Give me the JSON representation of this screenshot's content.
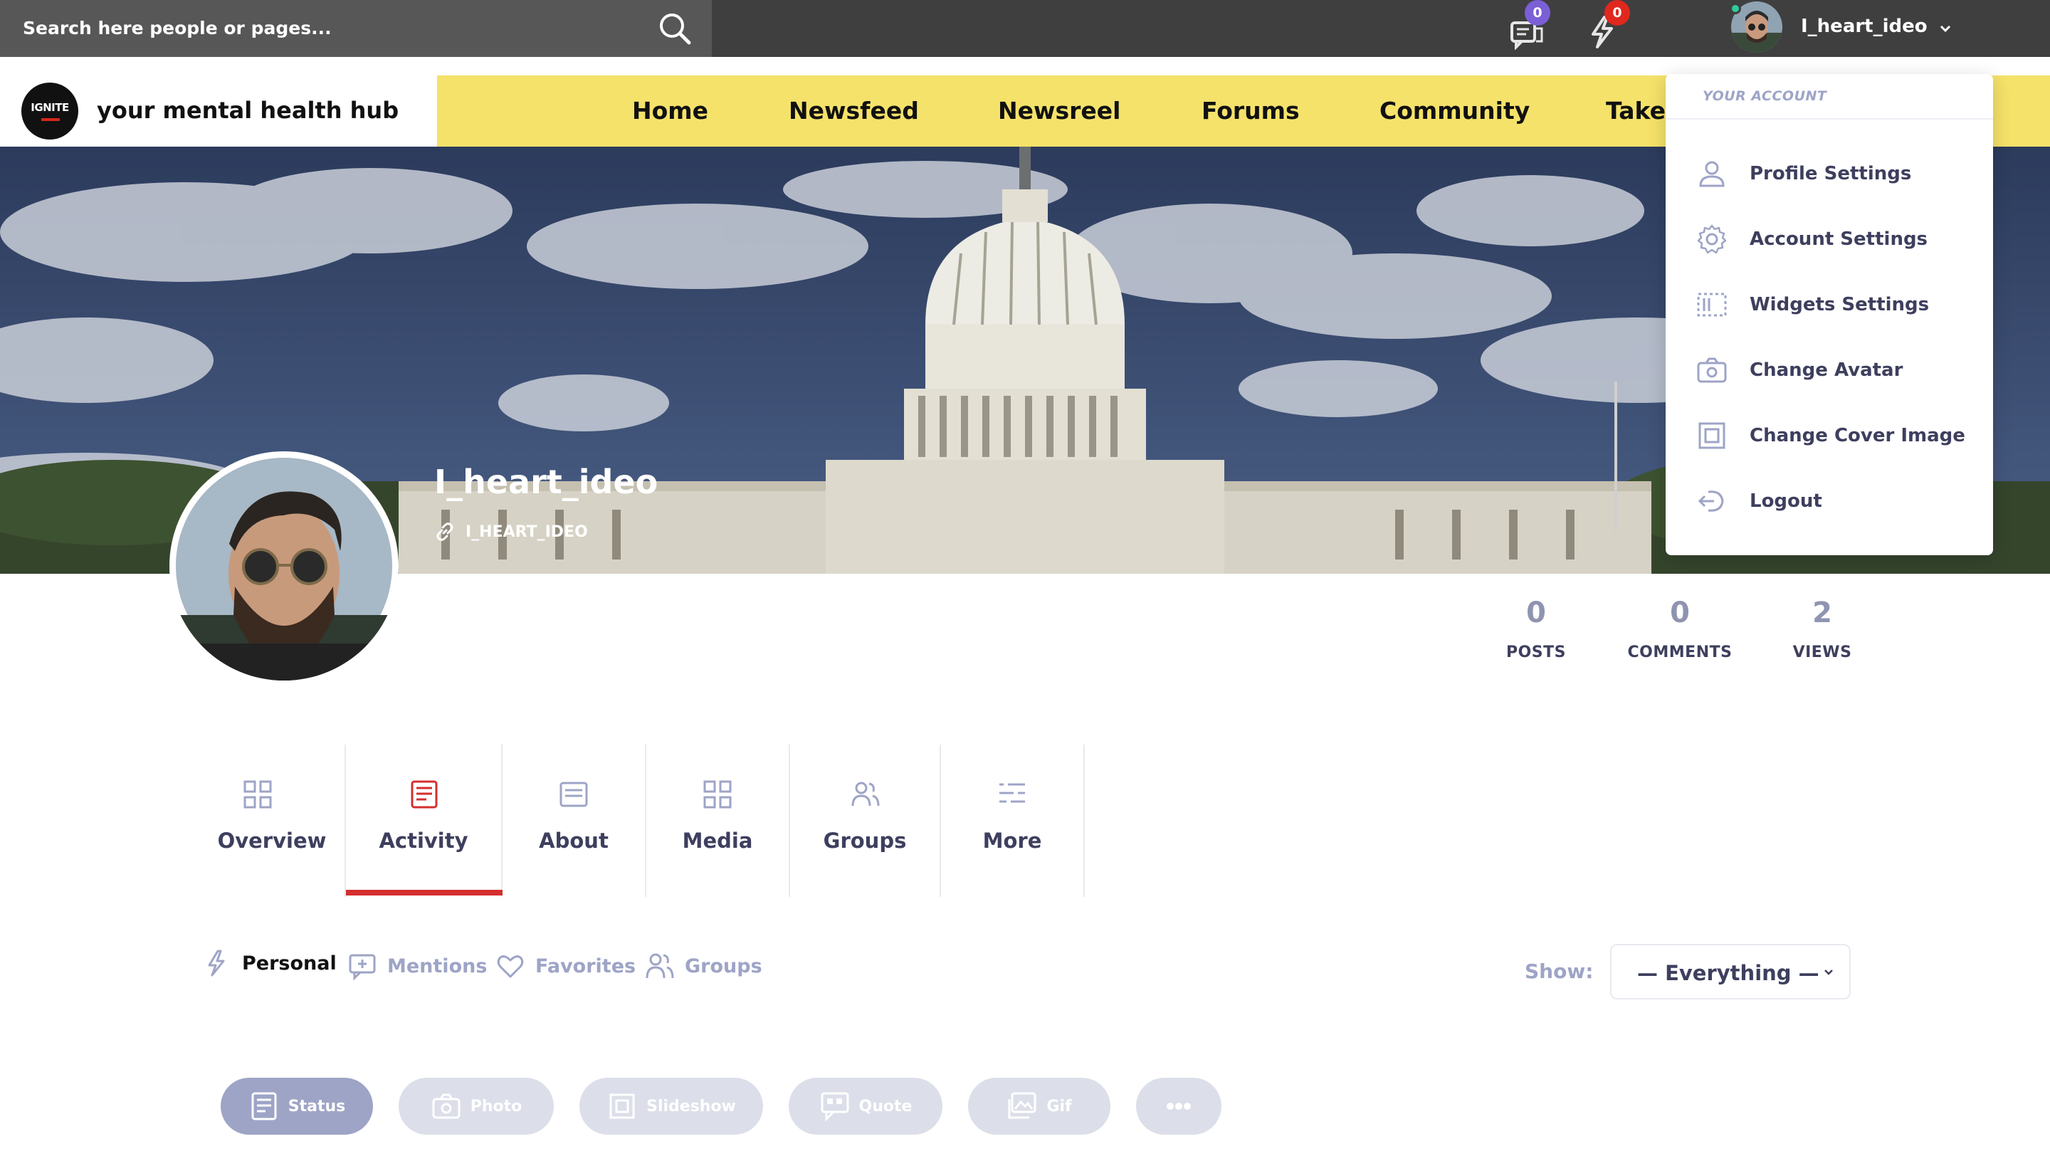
{
  "search": {
    "placeholder": "Search here people or pages..."
  },
  "topbar": {
    "messages_count": "0",
    "notifications_count": "0",
    "username": "I_heart_ideo"
  },
  "site": {
    "logo_text": "IGNITE",
    "tagline": "your mental health hub"
  },
  "nav": {
    "items": [
      "Home",
      "Newsfeed",
      "Newsreel",
      "Forums",
      "Community",
      "Take"
    ]
  },
  "profile": {
    "name": "I_heart_ideo",
    "handle": "I_HEART_IDEO"
  },
  "account_menu": {
    "title": "YOUR ACCOUNT",
    "items": [
      {
        "label": "Profile Settings",
        "icon": "user-icon"
      },
      {
        "label": "Account Settings",
        "icon": "gear-icon"
      },
      {
        "label": "Widgets Settings",
        "icon": "widgets-icon"
      },
      {
        "label": "Change Avatar",
        "icon": "camera-icon"
      },
      {
        "label": "Change Cover Image",
        "icon": "image-frame-icon"
      },
      {
        "label": "Logout",
        "icon": "logout-icon"
      }
    ]
  },
  "stats": [
    {
      "value": "0",
      "label": "POSTS"
    },
    {
      "value": "0",
      "label": "COMMENTS"
    },
    {
      "value": "2",
      "label": "VIEWS"
    }
  ],
  "profile_tabs": [
    {
      "label": "Overview",
      "icon": "grid-icon",
      "active": false
    },
    {
      "label": "Activity",
      "icon": "activity-icon",
      "active": true
    },
    {
      "label": "About",
      "icon": "info-card-icon",
      "active": false
    },
    {
      "label": "Media",
      "icon": "grid-icon",
      "active": false
    },
    {
      "label": "Groups",
      "icon": "group-icon",
      "active": false
    },
    {
      "label": "More",
      "icon": "list-icon",
      "active": false
    }
  ],
  "activity_filters": [
    {
      "label": "Personal",
      "icon": "bolt-icon",
      "active": true
    },
    {
      "label": "Mentions",
      "icon": "mention-icon",
      "active": false
    },
    {
      "label": "Favorites",
      "icon": "heart-icon",
      "active": false
    },
    {
      "label": "Groups",
      "icon": "group-icon",
      "active": false
    }
  ],
  "show_filter": {
    "label": "Show:",
    "value": "— Everything —"
  },
  "post_types": [
    {
      "label": "Status",
      "icon": "status-icon",
      "active": true
    },
    {
      "label": "Photo",
      "icon": "camera-icon",
      "active": false
    },
    {
      "label": "Slideshow",
      "icon": "slideshow-icon",
      "active": false
    },
    {
      "label": "Quote",
      "icon": "quote-icon",
      "active": false
    },
    {
      "label": "Gif",
      "icon": "gif-icon",
      "active": false
    },
    {
      "label": "",
      "icon": "more-dots-icon",
      "active": false
    }
  ],
  "colors": {
    "topbar": "#3f3f3f",
    "search_bg": "#575757",
    "nav_bg": "#f5e26a",
    "messages_badge": "#7b5fd6",
    "notifications_badge": "#e0281e",
    "active_tab": "#d42e2e",
    "text_dark": "#3e3f5e",
    "text_muted": "#9ea4c6",
    "button_active": "#9ea4c6",
    "button_inactive": "#dcdfe9"
  }
}
